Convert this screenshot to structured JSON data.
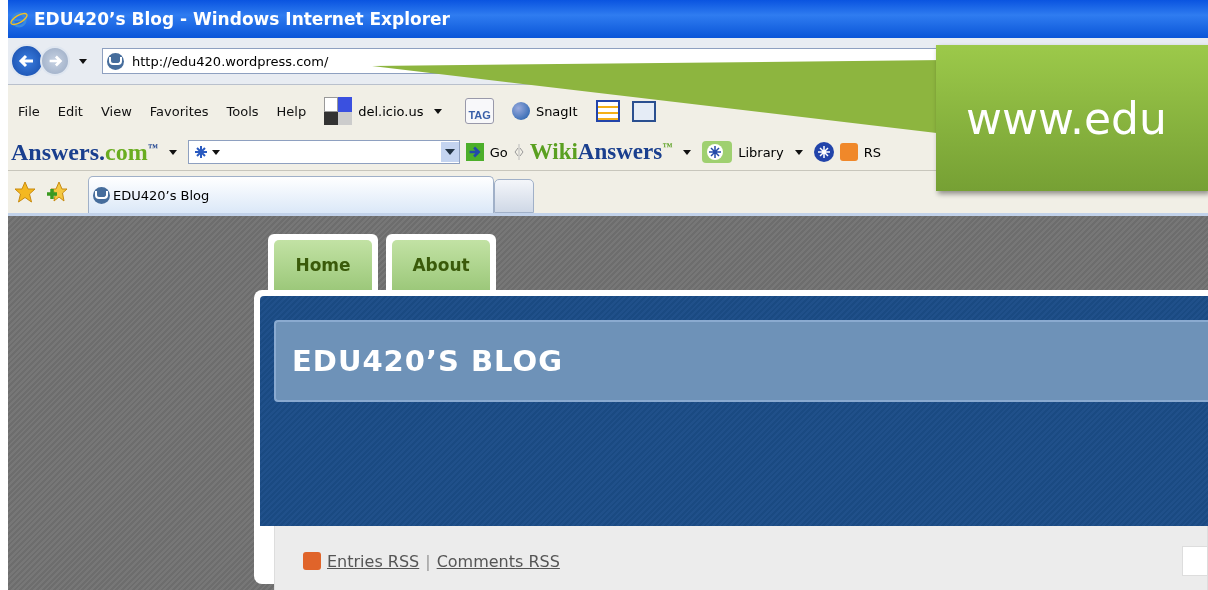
{
  "window": {
    "title": "EDU420’s Blog - Windows Internet Explorer"
  },
  "address_bar": {
    "value": "http://edu420.wordpress.com/"
  },
  "menu": [
    "File",
    "Edit",
    "View",
    "Favorites",
    "Tools",
    "Help"
  ],
  "toolbar": [
    {
      "kind": "delicious",
      "label": "del.icio.us"
    },
    {
      "kind": "tag",
      "label": "TAG"
    },
    {
      "kind": "snagit",
      "label": "SnagIt"
    },
    {
      "kind": "window"
    },
    {
      "kind": "note"
    }
  ],
  "answers_bar": {
    "logo": "Answers.",
    "logo_suffix": "com",
    "logo_mark": "™",
    "go": "Go",
    "wiki": "Wiki",
    "wiki_answers": "Answers",
    "wiki_mark": "™",
    "library": "Library",
    "rss": "RS"
  },
  "tabs": [
    {
      "title": "EDU420’s Blog",
      "selected": true
    }
  ],
  "blog": {
    "nav": [
      "Home",
      "About"
    ],
    "title": "EDU420’S BLOG",
    "feeds": [
      "Entries RSS",
      "Comments RSS"
    ],
    "separator": "|"
  },
  "callout": {
    "text": "www.edu"
  }
}
